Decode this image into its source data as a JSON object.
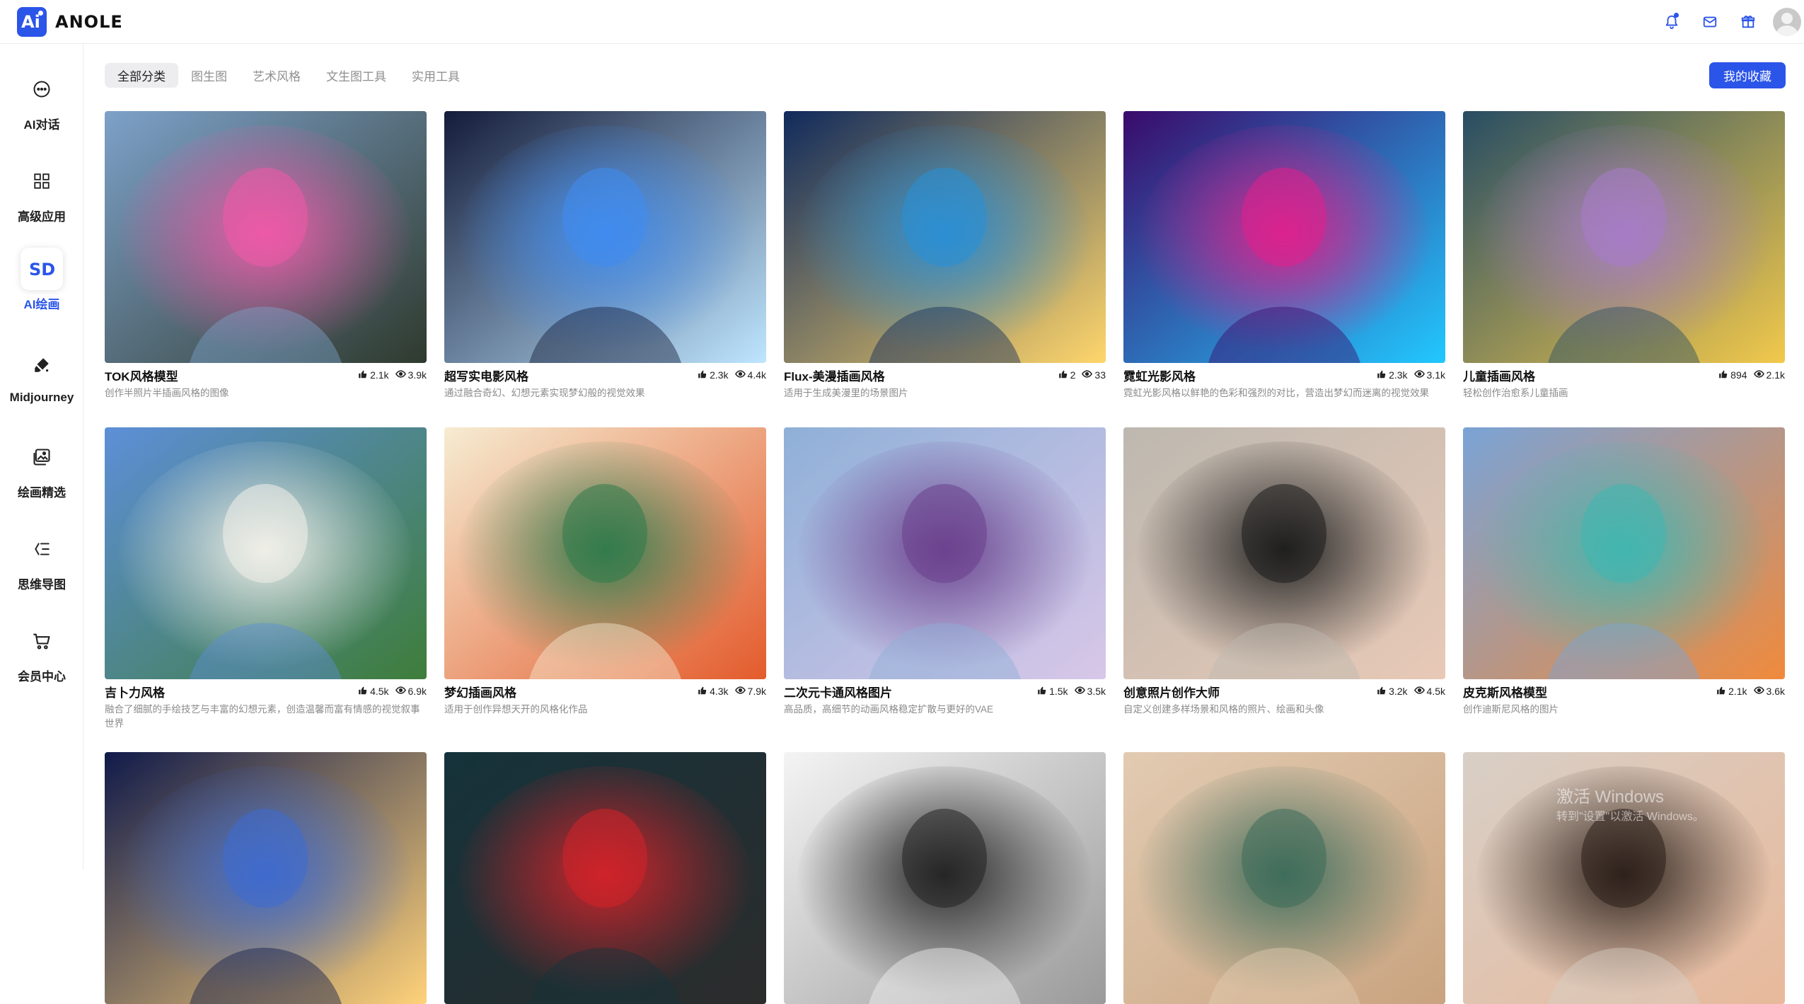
{
  "header": {
    "logo_text": "ANOLE",
    "logo_mark": "Ai",
    "icons": [
      "bell-icon",
      "mail-icon",
      "gift-icon",
      "avatar"
    ],
    "accent_color": "#2b54e8"
  },
  "sidebar": {
    "items": [
      {
        "label": "AI对话",
        "icon": "chat-icon",
        "active": false
      },
      {
        "label": "高级应用",
        "icon": "apps-grid-icon",
        "active": false
      },
      {
        "label": "AI绘画",
        "icon": "sd-icon",
        "active": true
      },
      {
        "label": "Midjourney",
        "icon": "brush-icon",
        "active": false
      },
      {
        "label": "绘画精选",
        "icon": "gallery-icon",
        "active": false
      },
      {
        "label": "思维导图",
        "icon": "mindmap-icon",
        "active": false
      },
      {
        "label": "会员中心",
        "icon": "cart-icon",
        "active": false
      }
    ]
  },
  "tabs": [
    {
      "label": "全部分类",
      "active": true
    },
    {
      "label": "图生图",
      "active": false
    },
    {
      "label": "艺术风格",
      "active": false
    },
    {
      "label": "文生图工具",
      "active": false
    },
    {
      "label": "实用工具",
      "active": false
    }
  ],
  "favorites_button": "我的收藏",
  "cards": [
    {
      "title": "TOK风格模型",
      "likes": "2.1k",
      "views": "3.9k",
      "desc": "创作半照片半插画风格的图像",
      "palette": [
        "#7da1c9",
        "#f05aa8",
        "#2f3a2e"
      ]
    },
    {
      "title": "超写实电影风格",
      "likes": "2.3k",
      "views": "4.4k",
      "desc": "通过融合奇幻、幻想元素实现梦幻般的视觉效果",
      "palette": [
        "#141c3a",
        "#3f8cf0",
        "#bfe6ff"
      ]
    },
    {
      "title": "Flux-美漫插画风格",
      "likes": "2",
      "views": "33",
      "desc": "适用于生成美漫里的场景图片",
      "palette": [
        "#0f2a5c",
        "#2a8fd6",
        "#ffd66b"
      ]
    },
    {
      "title": "霓虹光影风格",
      "likes": "2.3k",
      "views": "3.1k",
      "desc": "霓虹光影风格以鲜艳的色彩和强烈的对比，营造出梦幻而迷离的视觉效果",
      "palette": [
        "#3a0a6a",
        "#e0208c",
        "#22c8ff"
      ]
    },
    {
      "title": "儿童插画风格",
      "likes": "894",
      "views": "2.1k",
      "desc": "轻松创作治愈系儿童插画",
      "palette": [
        "#274d63",
        "#a77cc9",
        "#f2c94c"
      ]
    },
    {
      "title": "吉卜力风格",
      "likes": "4.5k",
      "views": "6.9k",
      "desc": "融合了细腻的手绘技艺与丰富的幻想元素，创造温馨而富有情感的视觉叙事世界",
      "palette": [
        "#5d8fd8",
        "#f3f1e9",
        "#3e7d3a"
      ]
    },
    {
      "title": "梦幻插画风格",
      "likes": "4.3k",
      "views": "7.9k",
      "desc": "适用于创作异想天开的风格化作品",
      "palette": [
        "#f6ecd2",
        "#2f7a4b",
        "#e35b2c"
      ]
    },
    {
      "title": "二次元卡通风格图片",
      "likes": "1.5k",
      "views": "3.5k",
      "desc": "高品质，高细节的动画风格稳定扩散与更好的VAE",
      "palette": [
        "#8fb0d8",
        "#6a3f8c",
        "#d8c7e8"
      ]
    },
    {
      "title": "创意照片创作大师",
      "likes": "3.2k",
      "views": "4.5k",
      "desc": "自定义创建多样场景和风格的照片、绘画和头像",
      "palette": [
        "#bdb8b0",
        "#1c1c1c",
        "#e8c9b6"
      ]
    },
    {
      "title": "皮克斯风格模型",
      "likes": "2.1k",
      "views": "3.6k",
      "desc": "创作迪斯尼风格的图片",
      "palette": [
        "#7aa3d6",
        "#3fb7b0",
        "#f08a3c"
      ]
    },
    {
      "title": "",
      "likes": "",
      "views": "",
      "desc": "",
      "palette": [
        "#101a4a",
        "#3e6bd0",
        "#ffd27a"
      ]
    },
    {
      "title": "",
      "likes": "",
      "views": "",
      "desc": "",
      "palette": [
        "#15323a",
        "#d3232a",
        "#2c2c2c"
      ]
    },
    {
      "title": "",
      "likes": "",
      "views": "",
      "desc": "",
      "palette": [
        "#f4f4f4",
        "#222222",
        "#9a9a9a"
      ]
    },
    {
      "title": "",
      "likes": "",
      "views": "",
      "desc": "",
      "palette": [
        "#e2cbb2",
        "#3c6b5a",
        "#c9a37f"
      ]
    },
    {
      "title": "",
      "likes": "",
      "views": "",
      "desc": "",
      "palette": [
        "#d8cfc6",
        "#2a1e18",
        "#e8b99b"
      ]
    }
  ],
  "watermark": {
    "line1": "激活 Windows",
    "line2": "转到\"设置\"以激活 Windows。"
  }
}
